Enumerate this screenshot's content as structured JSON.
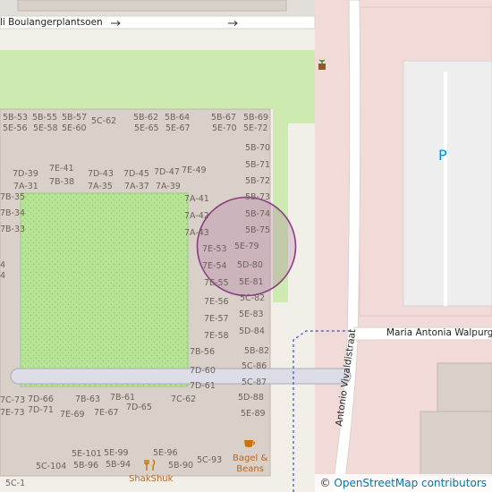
{
  "streets": {
    "boulanger": "li Boulangerplantsoen",
    "maria": "Maria Antonia Walpurg",
    "vivaldi": "Antonio Vivaldistraat"
  },
  "parking_label": "P",
  "pois": {
    "shakshuk": "ShakShuk",
    "bagel_line1": "Bagel &",
    "bagel_line2": "Beans"
  },
  "attribution": {
    "symbol": "©",
    "text": "OpenStreetMap contributors"
  },
  "house_numbers": [
    "5B-53",
    "5B-55",
    "5B-57",
    "5C-62",
    "5B-62",
    "5B-64",
    "5B-67",
    "5B-69",
    "5E-56",
    "5E-58",
    "5E-60",
    "5E-65",
    "5E-67",
    "5E-70",
    "5E-72",
    "5B-70",
    "5B-71",
    "5B-72",
    "5B-73",
    "5B-74",
    "5B-75",
    "7D-39",
    "7E-41",
    "7D-43",
    "7D-45",
    "7D-47",
    "7E-49",
    "7A-31",
    "7B-38",
    "7A-35",
    "7A-37",
    "7A-39",
    "7B-35",
    "7A-41",
    "7B-34",
    "7A-42",
    "7B-33",
    "7A-43",
    "7E-53",
    "5E-79",
    "7E-54",
    "5D-80",
    "7E-55",
    "5E-81",
    "7E-56",
    "5C-82",
    "7E-57",
    "5E-83",
    "7E-58",
    "5D-84",
    "7B-56",
    "5B-82",
    "7D-60",
    "5C-86",
    "7D-61",
    "5C-87",
    "7C-73",
    "7D-66",
    "7B-63",
    "7B-61",
    "7C-62",
    "5D-88",
    "7E-73",
    "7D-71",
    "7E-69",
    "7E-67",
    "7D-65",
    "5E-89",
    "5E-101",
    "5E-99",
    "5E-96",
    "5B-96",
    "5B-94",
    "5B-90",
    "5C-93",
    "5C-104",
    "5C-1",
    "4",
    "4"
  ]
}
